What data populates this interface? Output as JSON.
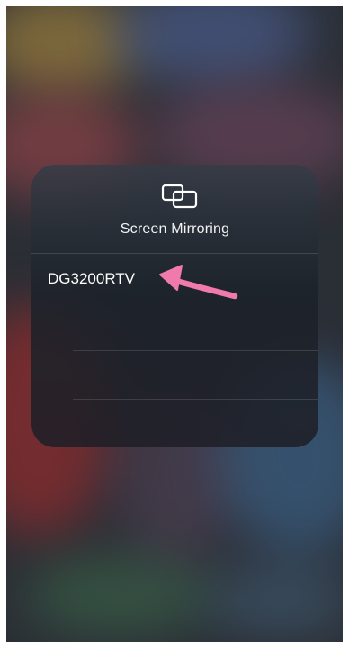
{
  "panel": {
    "title": "Screen Mirroring",
    "icon": "screen-mirroring-icon"
  },
  "devices": [
    {
      "name": "DG3200RTV"
    }
  ],
  "annotation": {
    "icon": "pointer-arrow-icon",
    "color": "#f07aa9"
  }
}
